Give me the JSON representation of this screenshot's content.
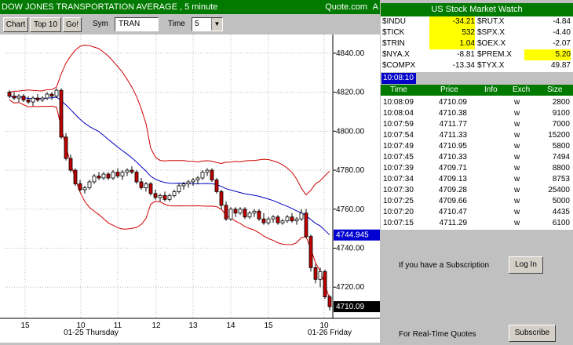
{
  "title_bar": {
    "title": "DOW JONES TRANSPORTATION AVERAGE , 5 minute",
    "source": "Quote.com",
    "icon_letter": "A"
  },
  "toolbar": {
    "chart_label": "Chart",
    "top10_label": "Top 10",
    "go_label": "Go!",
    "sym_label": "Sym",
    "sym_value": "TRAN",
    "time_label": "Time",
    "time_value": "5"
  },
  "chart_data": {
    "type": "candlestick",
    "y_ticks": [
      "4840.00",
      "4820.00",
      "4800.00",
      "4780.00",
      "4760.00",
      "4740.00",
      "4720.00"
    ],
    "y_tick_values": [
      4840,
      4820,
      4800,
      4780,
      4760,
      4740,
      4720
    ],
    "ylim": [
      4704,
      4848
    ],
    "x_ticks": [
      "15",
      "10",
      "11",
      "12",
      "13",
      "14",
      "15",
      "10"
    ],
    "x_date_labels": [
      "01-25 Thursday",
      "01-26 Friday"
    ],
    "last_price_label": "4710.09",
    "ma_label": "4744.945",
    "candles": [
      [
        4820,
        4821,
        4817,
        4818
      ],
      [
        4818,
        4820,
        4816,
        4817
      ],
      [
        4817,
        4819,
        4815,
        4818
      ],
      [
        4818,
        4819,
        4815,
        4816
      ],
      [
        4816,
        4818,
        4814,
        4815
      ],
      [
        4815,
        4818,
        4813,
        4817
      ],
      [
        4817,
        4819,
        4815,
        4816
      ],
      [
        4816,
        4818,
        4815,
        4817
      ],
      [
        4817,
        4820,
        4816,
        4819
      ],
      [
        4819,
        4820,
        4816,
        4818
      ],
      [
        4818,
        4822,
        4817,
        4821
      ],
      [
        4821,
        4822,
        4796,
        4797
      ],
      [
        4797,
        4799,
        4785,
        4786
      ],
      [
        4786,
        4788,
        4779,
        4780
      ],
      [
        4780,
        4781,
        4772,
        4773
      ],
      [
        4773,
        4775,
        4769,
        4770
      ],
      [
        4770,
        4772,
        4768,
        4771
      ],
      [
        4771,
        4775,
        4770,
        4774
      ],
      [
        4774,
        4778,
        4773,
        4777
      ],
      [
        4777,
        4779,
        4775,
        4776
      ],
      [
        4776,
        4779,
        4775,
        4778
      ],
      [
        4778,
        4779,
        4775,
        4776
      ],
      [
        4776,
        4780,
        4775,
        4779
      ],
      [
        4779,
        4781,
        4776,
        4777
      ],
      [
        4777,
        4780,
        4775,
        4779
      ],
      [
        4779,
        4781,
        4777,
        4780
      ],
      [
        4780,
        4782,
        4778,
        4779
      ],
      [
        4779,
        4780,
        4773,
        4774
      ],
      [
        4774,
        4776,
        4770,
        4771
      ],
      [
        4771,
        4774,
        4769,
        4773
      ],
      [
        4773,
        4774,
        4767,
        4768
      ],
      [
        4768,
        4770,
        4765,
        4766
      ],
      [
        4766,
        4768,
        4764,
        4767
      ],
      [
        4767,
        4769,
        4764,
        4765
      ],
      [
        4765,
        4768,
        4764,
        4767
      ],
      [
        4767,
        4770,
        4766,
        4769
      ],
      [
        4769,
        4773,
        4768,
        4772
      ],
      [
        4772,
        4774,
        4770,
        4773
      ],
      [
        4773,
        4775,
        4771,
        4774
      ],
      [
        4774,
        4776,
        4772,
        4775
      ],
      [
        4775,
        4777,
        4773,
        4776
      ],
      [
        4776,
        4780,
        4775,
        4779
      ],
      [
        4779,
        4781,
        4777,
        4780
      ],
      [
        4780,
        4781,
        4774,
        4775
      ],
      [
        4775,
        4776,
        4768,
        4769
      ],
      [
        4769,
        4770,
        4760,
        4762
      ],
      [
        4762,
        4764,
        4754,
        4755
      ],
      [
        4755,
        4761,
        4754,
        4760
      ],
      [
        4760,
        4761,
        4756,
        4758
      ],
      [
        4758,
        4761,
        4757,
        4760
      ],
      [
        4760,
        4761,
        4755,
        4756
      ],
      [
        4756,
        4759,
        4755,
        4758
      ],
      [
        4758,
        4760,
        4756,
        4759
      ],
      [
        4759,
        4760,
        4754,
        4755
      ],
      [
        4755,
        4758,
        4752,
        4753
      ],
      [
        4753,
        4756,
        4752,
        4755
      ],
      [
        4755,
        4757,
        4753,
        4756
      ],
      [
        4756,
        4757,
        4752,
        4753
      ],
      [
        4753,
        4755,
        4752,
        4754
      ],
      [
        4754,
        4757,
        4753,
        4756
      ],
      [
        4756,
        4758,
        4753,
        4754
      ],
      [
        4754,
        4756,
        4752,
        4755
      ],
      [
        4755,
        4760,
        4754,
        4758
      ],
      [
        4758,
        4760,
        4745,
        4746
      ],
      [
        4746,
        4747,
        4728,
        4730
      ],
      [
        4730,
        4732,
        4722,
        4724
      ],
      [
        4724,
        4730,
        4720,
        4728
      ],
      [
        4728,
        4729,
        4714,
        4715
      ],
      [
        4715,
        4716,
        4708,
        4710
      ]
    ]
  },
  "market_watch": {
    "title": "US Stock Market Watch",
    "rows": [
      {
        "s1": "$INDU",
        "v1": "-34.21",
        "h1": true,
        "s2": "$RUT.X",
        "v2": "-4.84",
        "h2": false
      },
      {
        "s1": "$TICK",
        "v1": "532",
        "h1": true,
        "s2": "$SPX.X",
        "v2": "-4.40",
        "h2": false
      },
      {
        "s1": "$TRIN",
        "v1": "1.04",
        "h1": true,
        "s2": "$OEX.X",
        "v2": "-2.07",
        "h2": false
      },
      {
        "s1": "$NYA.X",
        "v1": "-8.81",
        "h1": false,
        "s2": "$PREM.X",
        "v2": "5.20",
        "h2": true
      },
      {
        "s1": "$COMPX",
        "v1": "-13.34",
        "h1": false,
        "s2": "$TYX.X",
        "v2": "49.87",
        "h2": false
      }
    ]
  },
  "clock": "10:08:10",
  "time_sales": {
    "headers": [
      "Time",
      "Price",
      "Info",
      "Exch",
      "Size"
    ],
    "rows": [
      [
        "10:08:09",
        "4710.09",
        "",
        "w",
        "2800"
      ],
      [
        "10:08:04",
        "4710.38",
        "",
        "w",
        "9100"
      ],
      [
        "10:07:59",
        "4711.77",
        "",
        "w",
        "7000"
      ],
      [
        "10:07:54",
        "4711.33",
        "",
        "w",
        "15200"
      ],
      [
        "10:07:49",
        "4710.95",
        "",
        "w",
        "5800"
      ],
      [
        "10:07:45",
        "4710.33",
        "",
        "w",
        "7494"
      ],
      [
        "10:07:39",
        "4709.71",
        "",
        "w",
        "8800"
      ],
      [
        "10:07:34",
        "4709.13",
        "",
        "w",
        "8753"
      ],
      [
        "10:07:30",
        "4709.28",
        "",
        "w",
        "25400"
      ],
      [
        "10:07:25",
        "4709.66",
        "",
        "w",
        "5000"
      ],
      [
        "10:07:20",
        "4710.47",
        "",
        "w",
        "4435"
      ],
      [
        "10:07:15",
        "4711.29",
        "",
        "w",
        "6100"
      ]
    ]
  },
  "subscription": {
    "text1": "If you have a Subscription",
    "login_label": "Log In",
    "text2": "For Real-Time Quotes",
    "subscribe_label": "Subscribe"
  }
}
